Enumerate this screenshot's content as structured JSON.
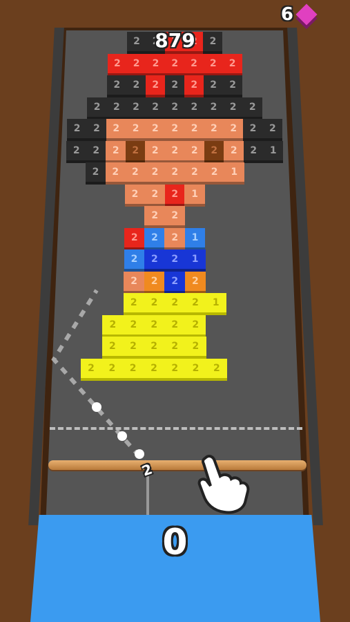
{
  "hud": {
    "score": "879",
    "gem_count": "6",
    "gem_icon": "pink-gem-icon"
  },
  "launcher": {
    "ball_count": "0",
    "aim_value": "2"
  },
  "tutorial": {
    "hand_icon": "pointing-hand-icon"
  },
  "colors": {
    "red": "#e8251c",
    "black": "#2b2b2b",
    "skin": "#e8875a",
    "darkbrown": "#7a3c12",
    "blue": "#2f7fe8",
    "navy": "#1836d6",
    "orange": "#f08a1f",
    "yellow": "#f2f21c"
  },
  "pixel_rows": [
    [
      "_",
      "_",
      "_",
      "k2",
      "k2",
      "r2",
      "r2",
      "k2",
      "_",
      "_",
      "_"
    ],
    [
      "_",
      "_",
      "r2",
      "r2",
      "r2",
      "r2",
      "r2",
      "r2",
      "r2",
      "_",
      "_"
    ],
    [
      "_",
      "_",
      "k2",
      "k2",
      "r2",
      "k2",
      "r2",
      "k2",
      "k2",
      "_",
      "_"
    ],
    [
      "_",
      "k2",
      "k2",
      "k2",
      "k2",
      "k2",
      "k2",
      "k2",
      "k2",
      "k2",
      "_"
    ],
    [
      "k2",
      "k2",
      "s2",
      "s2",
      "s2",
      "s2",
      "s2",
      "s2",
      "s2",
      "k2",
      "k2"
    ],
    [
      "k2",
      "k2",
      "s2",
      "d2",
      "s2",
      "s2",
      "s2",
      "d2",
      "s2",
      "k2",
      "k1"
    ],
    [
      "_",
      "k2",
      "s2",
      "s2",
      "s2",
      "s2",
      "s2",
      "s2",
      "s1",
      "_",
      "_"
    ],
    [
      "_",
      "_",
      "_",
      "s2",
      "s2",
      "r2",
      "s1",
      "_",
      "_",
      "_",
      "_"
    ],
    [
      "_",
      "_",
      "_",
      "_",
      "s2",
      "s2",
      "_",
      "_",
      "_",
      "_",
      "_"
    ],
    [
      "_",
      "_",
      "_",
      "r2",
      "b2",
      "s2",
      "b1",
      "_",
      "_",
      "_",
      "_"
    ],
    [
      "_",
      "_",
      "_",
      "b2",
      "n2",
      "n2",
      "n1",
      "_",
      "_",
      "_",
      "_"
    ],
    [
      "_",
      "_",
      "_",
      "s2",
      "o2",
      "n2",
      "o2",
      "_",
      "_",
      "_",
      "_"
    ],
    [
      "_",
      "_",
      "_",
      "y2",
      "y2",
      "y2",
      "y2",
      "y1",
      "_",
      "_",
      "_"
    ],
    [
      "_",
      "_",
      "y2",
      "y2",
      "y2",
      "y2",
      "y2",
      "_",
      "_",
      "_",
      "_"
    ],
    [
      "_",
      "_",
      "y2",
      "y2",
      "y2",
      "y2",
      "y2",
      "_",
      "_",
      "_",
      "_"
    ],
    [
      "_",
      "y2",
      "y2",
      "y2",
      "y2",
      "y2",
      "y2",
      "y2",
      "_",
      "_",
      "_"
    ]
  ]
}
